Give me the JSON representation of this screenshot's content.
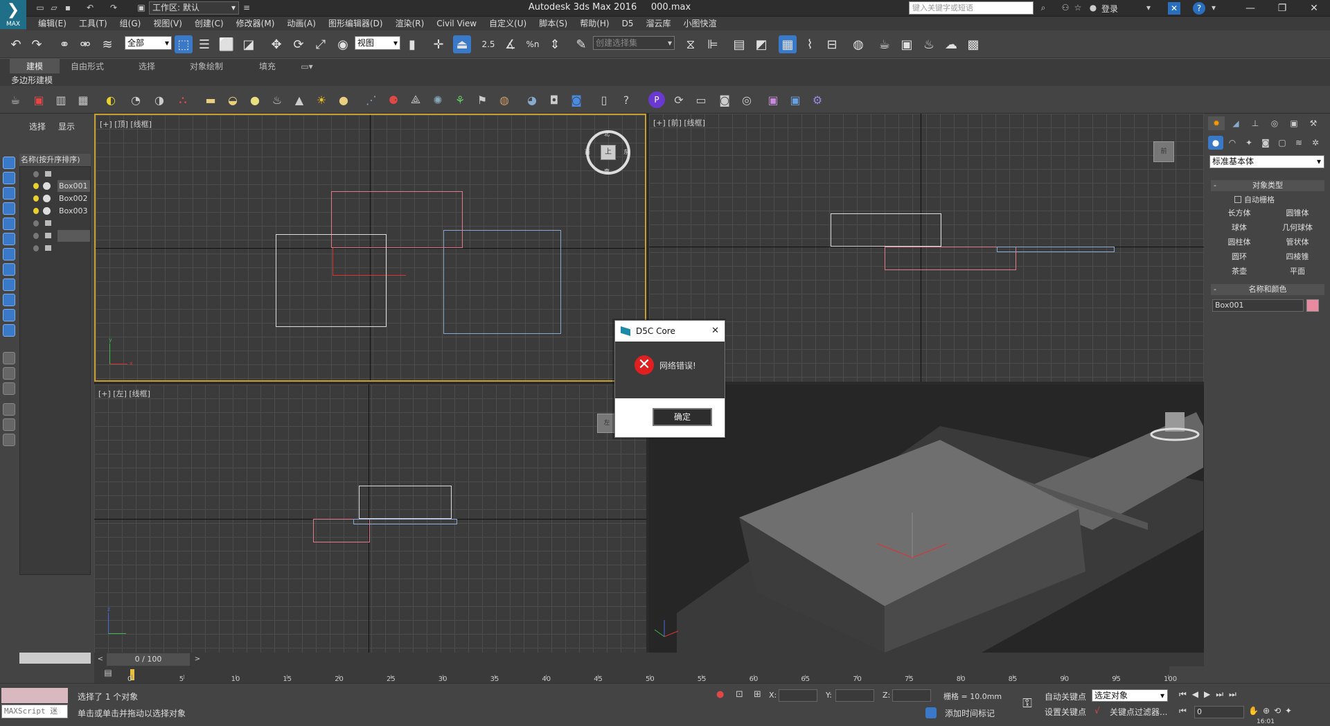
{
  "title_bar": {
    "workspace_label": "工作区: 默认",
    "app_title": "Autodesk 3ds Max 2016",
    "file_name": "000.max",
    "search_placeholder": "键入关键字或短语",
    "login_label": "登录",
    "logo_text": "MAX",
    "help_icon_text": "?"
  },
  "menus": [
    "编辑(E)",
    "工具(T)",
    "组(G)",
    "视图(V)",
    "创建(C)",
    "修改器(M)",
    "动画(A)",
    "图形编辑器(D)",
    "渲染(R)",
    "Civil View",
    "自定义(U)",
    "脚本(S)",
    "帮助(H)",
    "D5",
    "溜云库",
    "小图快渲"
  ],
  "toolbar": {
    "filter_value": "全部",
    "ref_coord_value": "视图",
    "named_selection_value": "创建选择集",
    "snap_text": "2.5",
    "percent_snap_text": "%n"
  },
  "ribbon": {
    "tabs": [
      "建模",
      "自由形式",
      "选择",
      "对象绘制",
      "填充"
    ],
    "sub_label": "多边形建模"
  },
  "scene_explorer": {
    "tabs": [
      "选择",
      "显示"
    ],
    "header": "名称(按升序排序)",
    "objects": [
      "Box001",
      "Box002",
      "Box003"
    ]
  },
  "viewports": {
    "top_label": "[+] [顶] [线框]",
    "front_label": "[+] [前] [线框]",
    "left_label": "[+] [左] [线框]",
    "viewcube_top": "上",
    "viewcube_front": "前",
    "viewcube_left": "左",
    "compass_north": "北",
    "compass_south": "南",
    "compass_east": "东",
    "compass_west": "西",
    "axis_x": "x",
    "axis_y": "y",
    "axis_z": "z"
  },
  "command_panel": {
    "dropdown_value": "标准基本体",
    "object_type_title": "对象类型",
    "auto_grid_label": "自动栅格",
    "buttons": [
      "长方体",
      "圆锥体",
      "球体",
      "几何球体",
      "圆柱体",
      "管状体",
      "圆环",
      "四棱锥",
      "茶壶",
      "平面"
    ],
    "name_color_title": "名称和颜色",
    "object_name": "Box001",
    "object_color": "#e98aa0"
  },
  "timeline": {
    "frame_label": "0 / 100",
    "ticks": [
      "0",
      "5",
      "10",
      "15",
      "20",
      "25",
      "30",
      "35",
      "40",
      "45",
      "50",
      "55",
      "60",
      "65",
      "70",
      "75",
      "80",
      "85",
      "90",
      "95",
      "100"
    ]
  },
  "status": {
    "maxscript_placeholder": "MAXScript 迷",
    "selection_status": "选择了 1 个对象",
    "prompt": "单击或单击并拖动以选择对象",
    "x_label": "X:",
    "y_label": "Y:",
    "z_label": "Z:",
    "grid_label": "栅格 = 10.0mm",
    "add_time_tag": "添加时间标记",
    "auto_key": "自动关键点",
    "set_key": "设置关键点",
    "key_mode_value": "选定对象",
    "key_filters": "关键点过滤器...",
    "frame_value": "0",
    "clock": "16:01"
  },
  "dialog": {
    "title": "D5C Core",
    "message": "网络错误!",
    "ok_label": "确定",
    "close_glyph": "✕",
    "error_glyph": "✕"
  }
}
